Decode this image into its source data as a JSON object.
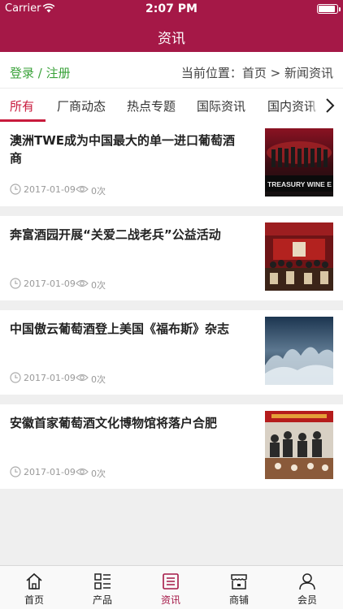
{
  "status": {
    "carrier": "Carrier",
    "time": "2:07 PM",
    "battery_level": 0.9
  },
  "header": {
    "title": "资讯"
  },
  "breadcrumb": {
    "login": "登录 / 注册",
    "location": "当前位置：首页 > 新闻资讯"
  },
  "tabs": [
    "所有",
    "厂商动态",
    "热点专题",
    "国际资讯",
    "国内资讯"
  ],
  "articles": [
    {
      "title": "澳洲TWE成为中国最大的单一进口葡萄酒商",
      "date": "2017-01-09",
      "views": "0次",
      "thumb_text": "TREASURY WINE E"
    },
    {
      "title": "奔富酒园开展“关爱二战老兵”公益活动",
      "date": "2017-01-09",
      "views": "0次"
    },
    {
      "title": "中国傲云葡萄酒登上美国《福布斯》杂志",
      "date": "2017-01-09",
      "views": "0次"
    },
    {
      "title": "安徽首家葡萄酒文化博物馆将落户合肥",
      "date": "2017-01-09",
      "views": "0次"
    }
  ],
  "tabbar": [
    "首页",
    "产品",
    "资讯",
    "商铺",
    "会员"
  ],
  "colors": {
    "brand": "#a51847",
    "accent_red": "#c81a3c",
    "login_green": "#3aa23a"
  }
}
